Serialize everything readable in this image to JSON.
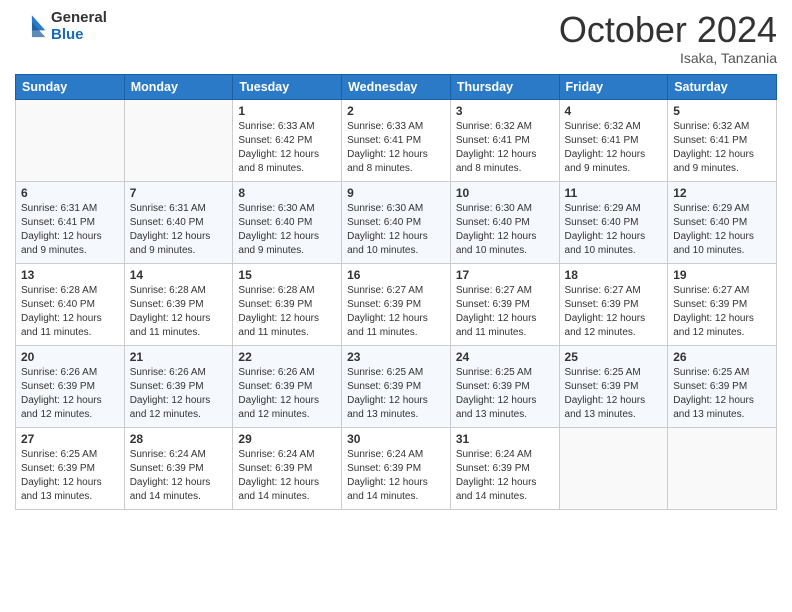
{
  "logo": {
    "general": "General",
    "blue": "Blue"
  },
  "title": "October 2024",
  "subtitle": "Isaka, Tanzania",
  "days_of_week": [
    "Sunday",
    "Monday",
    "Tuesday",
    "Wednesday",
    "Thursday",
    "Friday",
    "Saturday"
  ],
  "weeks": [
    [
      {
        "day": "",
        "info": ""
      },
      {
        "day": "",
        "info": ""
      },
      {
        "day": "1",
        "info": "Sunrise: 6:33 AM\nSunset: 6:42 PM\nDaylight: 12 hours and 8 minutes."
      },
      {
        "day": "2",
        "info": "Sunrise: 6:33 AM\nSunset: 6:41 PM\nDaylight: 12 hours and 8 minutes."
      },
      {
        "day": "3",
        "info": "Sunrise: 6:32 AM\nSunset: 6:41 PM\nDaylight: 12 hours and 8 minutes."
      },
      {
        "day": "4",
        "info": "Sunrise: 6:32 AM\nSunset: 6:41 PM\nDaylight: 12 hours and 9 minutes."
      },
      {
        "day": "5",
        "info": "Sunrise: 6:32 AM\nSunset: 6:41 PM\nDaylight: 12 hours and 9 minutes."
      }
    ],
    [
      {
        "day": "6",
        "info": "Sunrise: 6:31 AM\nSunset: 6:41 PM\nDaylight: 12 hours and 9 minutes."
      },
      {
        "day": "7",
        "info": "Sunrise: 6:31 AM\nSunset: 6:40 PM\nDaylight: 12 hours and 9 minutes."
      },
      {
        "day": "8",
        "info": "Sunrise: 6:30 AM\nSunset: 6:40 PM\nDaylight: 12 hours and 9 minutes."
      },
      {
        "day": "9",
        "info": "Sunrise: 6:30 AM\nSunset: 6:40 PM\nDaylight: 12 hours and 10 minutes."
      },
      {
        "day": "10",
        "info": "Sunrise: 6:30 AM\nSunset: 6:40 PM\nDaylight: 12 hours and 10 minutes."
      },
      {
        "day": "11",
        "info": "Sunrise: 6:29 AM\nSunset: 6:40 PM\nDaylight: 12 hours and 10 minutes."
      },
      {
        "day": "12",
        "info": "Sunrise: 6:29 AM\nSunset: 6:40 PM\nDaylight: 12 hours and 10 minutes."
      }
    ],
    [
      {
        "day": "13",
        "info": "Sunrise: 6:28 AM\nSunset: 6:40 PM\nDaylight: 12 hours and 11 minutes."
      },
      {
        "day": "14",
        "info": "Sunrise: 6:28 AM\nSunset: 6:39 PM\nDaylight: 12 hours and 11 minutes."
      },
      {
        "day": "15",
        "info": "Sunrise: 6:28 AM\nSunset: 6:39 PM\nDaylight: 12 hours and 11 minutes."
      },
      {
        "day": "16",
        "info": "Sunrise: 6:27 AM\nSunset: 6:39 PM\nDaylight: 12 hours and 11 minutes."
      },
      {
        "day": "17",
        "info": "Sunrise: 6:27 AM\nSunset: 6:39 PM\nDaylight: 12 hours and 11 minutes."
      },
      {
        "day": "18",
        "info": "Sunrise: 6:27 AM\nSunset: 6:39 PM\nDaylight: 12 hours and 12 minutes."
      },
      {
        "day": "19",
        "info": "Sunrise: 6:27 AM\nSunset: 6:39 PM\nDaylight: 12 hours and 12 minutes."
      }
    ],
    [
      {
        "day": "20",
        "info": "Sunrise: 6:26 AM\nSunset: 6:39 PM\nDaylight: 12 hours and 12 minutes."
      },
      {
        "day": "21",
        "info": "Sunrise: 6:26 AM\nSunset: 6:39 PM\nDaylight: 12 hours and 12 minutes."
      },
      {
        "day": "22",
        "info": "Sunrise: 6:26 AM\nSunset: 6:39 PM\nDaylight: 12 hours and 12 minutes."
      },
      {
        "day": "23",
        "info": "Sunrise: 6:25 AM\nSunset: 6:39 PM\nDaylight: 12 hours and 13 minutes."
      },
      {
        "day": "24",
        "info": "Sunrise: 6:25 AM\nSunset: 6:39 PM\nDaylight: 12 hours and 13 minutes."
      },
      {
        "day": "25",
        "info": "Sunrise: 6:25 AM\nSunset: 6:39 PM\nDaylight: 12 hours and 13 minutes."
      },
      {
        "day": "26",
        "info": "Sunrise: 6:25 AM\nSunset: 6:39 PM\nDaylight: 12 hours and 13 minutes."
      }
    ],
    [
      {
        "day": "27",
        "info": "Sunrise: 6:25 AM\nSunset: 6:39 PM\nDaylight: 12 hours and 13 minutes."
      },
      {
        "day": "28",
        "info": "Sunrise: 6:24 AM\nSunset: 6:39 PM\nDaylight: 12 hours and 14 minutes."
      },
      {
        "day": "29",
        "info": "Sunrise: 6:24 AM\nSunset: 6:39 PM\nDaylight: 12 hours and 14 minutes."
      },
      {
        "day": "30",
        "info": "Sunrise: 6:24 AM\nSunset: 6:39 PM\nDaylight: 12 hours and 14 minutes."
      },
      {
        "day": "31",
        "info": "Sunrise: 6:24 AM\nSunset: 6:39 PM\nDaylight: 12 hours and 14 minutes."
      },
      {
        "day": "",
        "info": ""
      },
      {
        "day": "",
        "info": ""
      }
    ]
  ]
}
